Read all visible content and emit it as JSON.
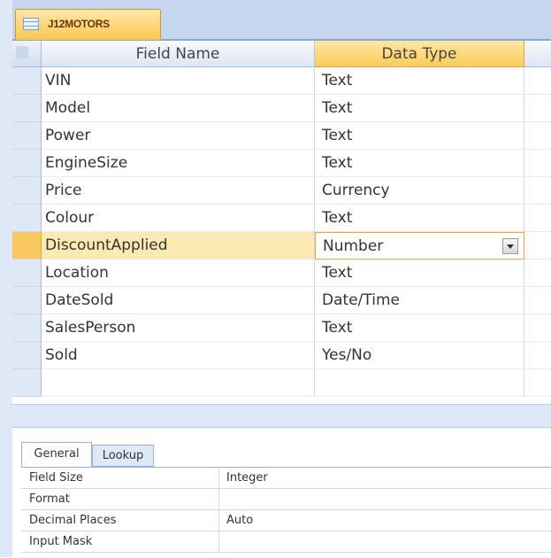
{
  "document_tab": {
    "title": "J12MOTORS",
    "icon": "table-icon"
  },
  "design_grid": {
    "columns": {
      "field_name": "Field Name",
      "data_type": "Data Type"
    },
    "rows": [
      {
        "field": "VIN",
        "type": "Text"
      },
      {
        "field": "Model",
        "type": "Text"
      },
      {
        "field": "Power",
        "type": "Text"
      },
      {
        "field": "EngineSize",
        "type": "Text"
      },
      {
        "field": "Price",
        "type": "Currency"
      },
      {
        "field": "Colour",
        "type": "Text"
      },
      {
        "field": "DiscountApplied",
        "type": "Number"
      },
      {
        "field": "Location",
        "type": "Text"
      },
      {
        "field": "DateSold",
        "type": "Date/Time"
      },
      {
        "field": "SalesPerson",
        "type": "Text"
      },
      {
        "field": "Sold",
        "type": "Yes/No"
      },
      {
        "field": "",
        "type": ""
      },
      {
        "field": "",
        "type": ""
      }
    ]
  },
  "field_properties": {
    "tabs": {
      "general": "General",
      "lookup": "Lookup"
    },
    "rows": [
      {
        "label": "Field Size",
        "value": "Integer"
      },
      {
        "label": "Format",
        "value": ""
      },
      {
        "label": "Decimal Places",
        "value": "Auto"
      },
      {
        "label": "Input Mask",
        "value": ""
      }
    ]
  },
  "colors": {
    "accent": "#f8cc5c",
    "frame": "#dfe8f6",
    "border": "#a8bfe0"
  }
}
